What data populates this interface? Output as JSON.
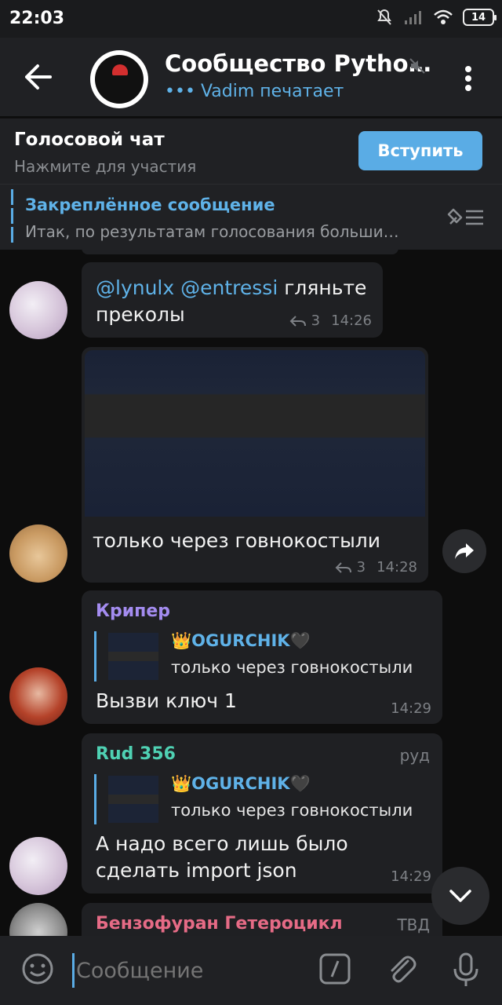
{
  "status": {
    "time": "22:03",
    "battery": "14"
  },
  "header": {
    "title": "Сообщество Pytho…",
    "typing_dots": "•••",
    "typing": "Vadim печатает"
  },
  "voice_chat": {
    "title": "Голосовой чат",
    "subtitle": "Нажмите для участия",
    "join_label": "Вступить"
  },
  "pinned": {
    "title": "Закреплённое сообщение",
    "text": "Итак, по результатам голосования больши…"
  },
  "messages": [
    {
      "mention1": "@lynulx",
      "mention2": "@entressi",
      "text1": " гляньте",
      "text2": "преколы",
      "replies": "3",
      "time": "14:26"
    },
    {
      "text": "только через говнокостыли",
      "replies": "3",
      "time": "14:28"
    },
    {
      "sender": "Крипер",
      "reply_name": "👑OGURCHIK🖤",
      "reply_text": "только через говнокостыли",
      "text": "Вызви ключ 1",
      "time": "14:29"
    },
    {
      "sender": "Rud 356",
      "tag": "руд",
      "reply_name": "👑OGURCHIK🖤",
      "reply_text": "только через говнокостыли",
      "text1": "А надо всего лишь было",
      "text2": "сделать import json",
      "time": "14:29"
    },
    {
      "sender": "Бензофуран Гетероцикл",
      "tag": "ТВД"
    }
  ],
  "input": {
    "placeholder": "Сообщение"
  },
  "colors": {
    "accent": "#5aace5",
    "bubble": "#1f2023",
    "header": "#202124"
  }
}
